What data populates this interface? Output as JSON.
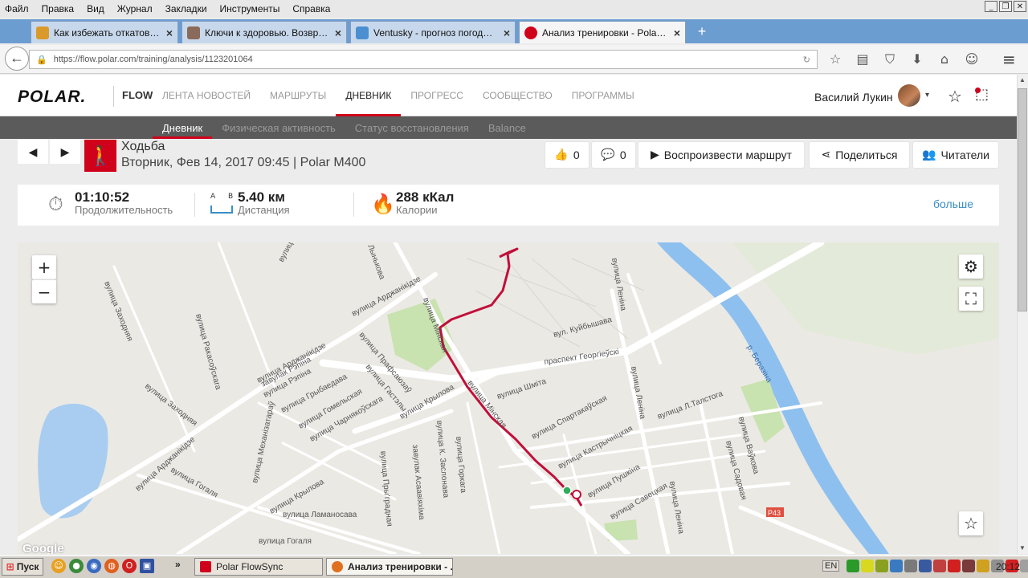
{
  "menubar": {
    "items": [
      "Файл",
      "Правка",
      "Вид",
      "Журнал",
      "Закладки",
      "Инструменты",
      "Справка"
    ]
  },
  "window_controls": {
    "minimize": "_",
    "restore": "❐",
    "close": "✕"
  },
  "tabs": [
    {
      "label": "Как избежать откатов в зр...",
      "favicon_color": "#d99a2b"
    },
    {
      "label": "Ключи к здоровью. Возвра...",
      "favicon_color": "#8a6a5a"
    },
    {
      "label": "Ventusky - прогноз погоды ...",
      "favicon_color": "#4b8fd0"
    },
    {
      "label": "Анализ тренировки - Polar F...",
      "favicon_color": "#d0021b"
    }
  ],
  "tab_close": "×",
  "new_tab": "+",
  "address": {
    "url": "https://flow.polar.com/training/analysis/1123201064",
    "lock_icon": "🔒",
    "reload_icon": "↻",
    "back_icon": "←"
  },
  "nav_icons": [
    "☆",
    "▤",
    "⛉",
    "⬇",
    "⌂",
    "☺"
  ],
  "menu_icon": "≡",
  "header": {
    "logo": "POLAR.",
    "flow": "FLOW",
    "nav": [
      "ЛЕНТА НОВОСТЕЙ",
      "МАРШРУТЫ",
      "ДНЕВНИК",
      "ПРОГРЕСС",
      "СООБЩЕСТВО",
      "ПРОГРАММЫ"
    ],
    "active_nav": 2,
    "user": "Василий Лукин",
    "caret": "▾",
    "star_icon": "☆",
    "chat_icon": "⬚"
  },
  "subnav": {
    "items": [
      "Дневник",
      "Физическая активность",
      "Статус восстановления",
      "Balance"
    ],
    "active": 0
  },
  "training": {
    "prev_icon": "◀",
    "next_icon": "▶",
    "sport_icon": "🚶",
    "sport": "Ходьба",
    "date": "Вторник, Фев 14, 2017 09:45 | Polar M400",
    "likes": "0",
    "comments": "0",
    "replay": "Воспроизвести маршрут",
    "share": "Поделиться",
    "readers": "Читатели",
    "like_icon": "👍",
    "comment_icon": "💬",
    "play_icon": "▶",
    "share_icon": "⋖",
    "readers_icon": "👥"
  },
  "summary": {
    "duration": {
      "value": "01:10:52",
      "label": "Продолжительность",
      "icon": "⏱"
    },
    "distance": {
      "value": "5.40 км",
      "label": "Дистанция",
      "a": "A",
      "b": "B"
    },
    "calories": {
      "value": "288 кКал",
      "label": "Калории",
      "icon": "🔥"
    },
    "more": "больше"
  },
  "map": {
    "zoom_in": "+",
    "zoom_out": "−",
    "settings_icon": "⚙",
    "fullscreen_icon": "⛶",
    "favorite_icon": "☆",
    "google": "Google",
    "route_color": "#c0103a",
    "labels": [
      "вулица Ульянаўская",
      "вулица Мінская",
      "Лынькова",
      "вулица Заходняя",
      "вулица Ракасоўскага",
      "вулица Арджанікідзе",
      "завулак Рэпіна",
      "вулица Рэпіна",
      "вулица Грыбаедава",
      "вулица Прафсаюзаў",
      "вулица Гастэлы",
      "вулица Крылова",
      "вулица Гомельская",
      "вулица Чарнякоўскага",
      "вулица Заходняя",
      "вулица Арджанікідзе",
      "вулица Гогаля",
      "вулица Механізатараў",
      "вулица Крылова",
      "вулица Ламаносава",
      "вулица Гогаля",
      "вулица Пры'градная",
      "завулак Асаавіяхіма",
      "вулица К. Заслонава",
      "вулица Горкага",
      "вулица Шміта",
      "вулица Мінская",
      "вулица Спартакаўская",
      "вулица Кастрычніцкая",
      "вулица Пушкіна",
      "вулица Савецкая",
      "вулица Леніна",
      "вулица Леніна",
      "вулица Леніна",
      "вул. Куйбышава",
      "праспект Георгіеўскі",
      "вулица Л.Талстога",
      "вулица Ваўкова",
      "вулица Садовая",
      "р. Беразіна",
      "P43"
    ]
  },
  "taskbar": {
    "start": "Пуск",
    "quick_icons": [
      {
        "g": "☺",
        "c": "#e8a020"
      },
      {
        "g": "●",
        "c": "#3a8a3a"
      },
      {
        "g": "◉",
        "c": "#3a6ac0"
      },
      {
        "g": "◍",
        "c": "#e06020"
      },
      {
        "g": "O",
        "c": "#d02020"
      },
      {
        "g": "▣",
        "c": "#3050a0"
      }
    ],
    "chevron": "»",
    "tasks": [
      {
        "label": "Polar FlowSync",
        "color": "#d0021b"
      },
      {
        "label": "Анализ тренировки - ...",
        "color": "#e07020"
      }
    ],
    "lang": "EN",
    "tray_colors": [
      "#2a9a2a",
      "#d8d820",
      "#8aa020",
      "#3a7ac0",
      "#7a7a7a",
      "#3a5aa0",
      "#c04040",
      "#d02020",
      "#7a3a3a",
      "#d0a020",
      "#909090",
      "#d02020",
      "#a0a0a0"
    ],
    "clock": "20:12"
  }
}
